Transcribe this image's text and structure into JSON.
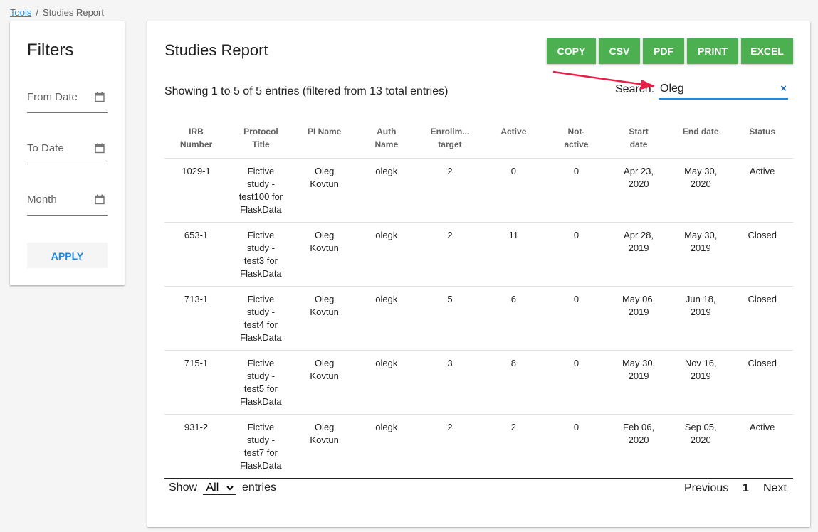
{
  "breadcrumb": {
    "root": "Tools",
    "separator": "/",
    "current": "Studies Report"
  },
  "filters": {
    "title": "Filters",
    "from_date_label": "From Date",
    "to_date_label": "To Date",
    "month_label": "Month",
    "apply_label": "APPLY"
  },
  "report": {
    "title": "Studies Report",
    "export_buttons": [
      "COPY",
      "CSV",
      "PDF",
      "PRINT",
      "EXCEL"
    ],
    "info": "Showing 1 to 5 of 5 entries (filtered from 13 total entries)",
    "search_label": "Search:",
    "search_value": "Oleg",
    "clear_icon": "×",
    "colors": {
      "export_bg": "#4caf50",
      "accent": "#1e88e5",
      "arrow": "#e91e48"
    }
  },
  "table": {
    "headers": [
      [
        "IRB",
        "Number"
      ],
      [
        "Protocol",
        "Title"
      ],
      [
        "PI Name"
      ],
      [
        "Auth",
        "Name"
      ],
      [
        "Enrollm...",
        "target"
      ],
      [
        "Active"
      ],
      [
        "Not-",
        "active"
      ],
      [
        "Start",
        "date"
      ],
      [
        "End date"
      ],
      [
        "Status"
      ]
    ],
    "rows": [
      {
        "irb": "1029-1",
        "title": [
          "Fictive",
          "study -",
          "test100 for",
          "FlaskData"
        ],
        "pi": [
          "Oleg",
          "Kovtun"
        ],
        "auth": "olegk",
        "enroll": "2",
        "active": "0",
        "not_active": "0",
        "start": [
          "Apr 23,",
          "2020"
        ],
        "end": [
          "May 30,",
          "2020"
        ],
        "status": "Active"
      },
      {
        "irb": "653-1",
        "title": [
          "Fictive",
          "study -",
          "test3 for",
          "FlaskData"
        ],
        "pi": [
          "Oleg",
          "Kovtun"
        ],
        "auth": "olegk",
        "enroll": "2",
        "active": "11",
        "not_active": "0",
        "start": [
          "Apr 28,",
          "2019"
        ],
        "end": [
          "May 30,",
          "2019"
        ],
        "status": "Closed"
      },
      {
        "irb": "713-1",
        "title": [
          "Fictive",
          "study -",
          "test4 for",
          "FlaskData"
        ],
        "pi": [
          "Oleg",
          "Kovtun"
        ],
        "auth": "olegk",
        "enroll": "5",
        "active": "6",
        "not_active": "0",
        "start": [
          "May 06,",
          "2019"
        ],
        "end": [
          "Jun 18,",
          "2019"
        ],
        "status": "Closed"
      },
      {
        "irb": "715-1",
        "title": [
          "Fictive",
          "study -",
          "test5 for",
          "FlaskData"
        ],
        "pi": [
          "Oleg",
          "Kovtun"
        ],
        "auth": "olegk",
        "enroll": "3",
        "active": "8",
        "not_active": "0",
        "start": [
          "May 30,",
          "2019"
        ],
        "end": [
          "Nov 16,",
          "2019"
        ],
        "status": "Closed"
      },
      {
        "irb": "931-2",
        "title": [
          "Fictive",
          "study -",
          "test7 for",
          "FlaskData"
        ],
        "pi": [
          "Oleg",
          "Kovtun"
        ],
        "auth": "olegk",
        "enroll": "2",
        "active": "2",
        "not_active": "0",
        "start": [
          "Feb 06,",
          "2020"
        ],
        "end": [
          "Sep 05,",
          "2020"
        ],
        "status": "Active"
      }
    ]
  },
  "footer": {
    "show_label": "Show",
    "page_size": "All",
    "entries_label": "entries",
    "previous_label": "Previous",
    "current_page": "1",
    "next_label": "Next"
  }
}
